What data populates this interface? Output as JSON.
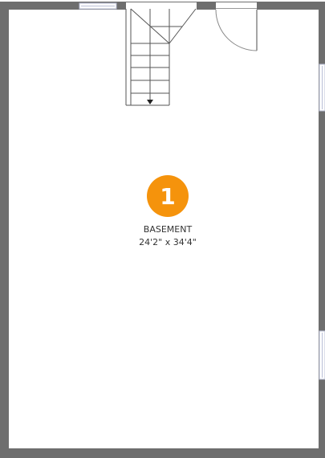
{
  "plan": {
    "wall_color": "#6e6e6e",
    "window_color": "#b9bfd6",
    "stair_direction": "down"
  },
  "room": {
    "number": "1",
    "name": "BASEMENT",
    "dimensions": "24'2\" x 34'4\"",
    "marker_color": "#f5930c"
  }
}
